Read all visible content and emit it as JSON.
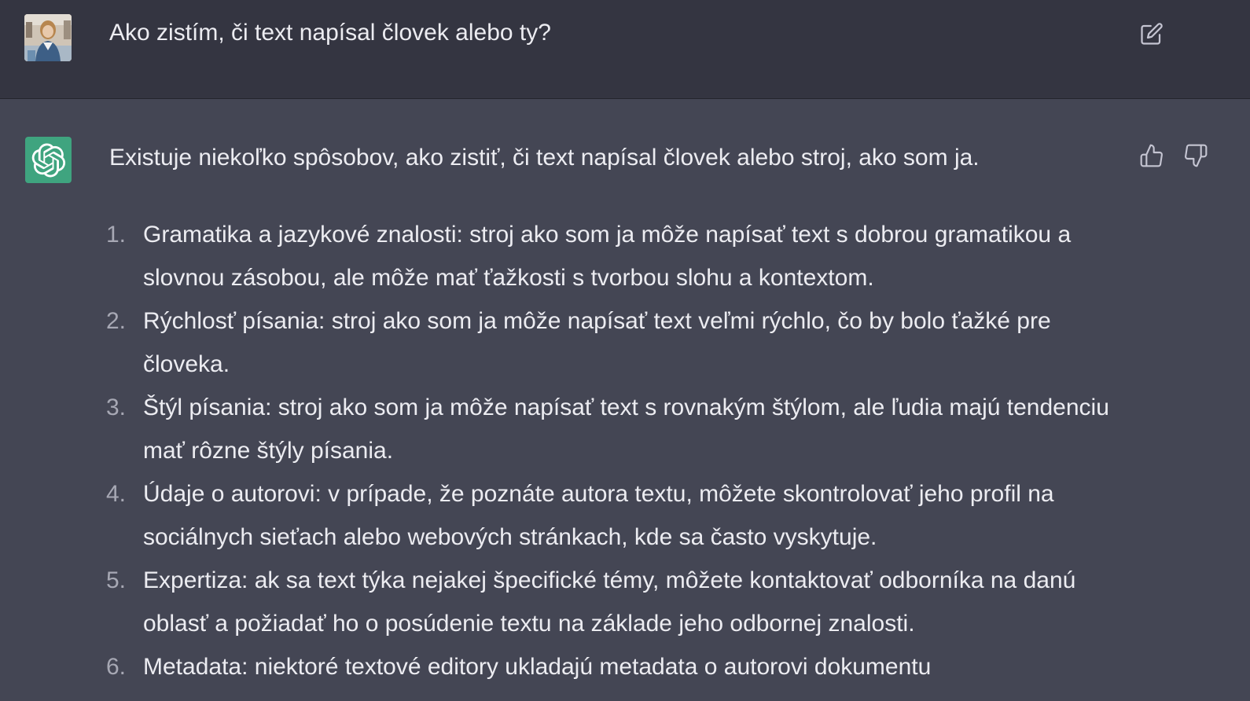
{
  "user_message": {
    "text": "Ako zistím, či text napísal človek alebo ty?",
    "avatar_icon": "user-photo-avatar",
    "edit_icon": "edit-pencil-icon"
  },
  "assistant_message": {
    "avatar_icon": "openai-logo-icon",
    "intro": "Existuje niekoľko spôsobov, ako zistiť, či text napísal človek alebo stroj, ako som ja.",
    "items": [
      {
        "number": "1.",
        "text": "Gramatika a jazykové znalosti: stroj ako som ja môže napísať text s dobrou gramatikou a slovnou zásobou, ale môže mať ťažkosti s tvorbou slohu a kontextom."
      },
      {
        "number": "2.",
        "text": "Rýchlosť písania: stroj ako som ja môže napísať text veľmi rýchlo, čo by bolo ťažké pre človeka."
      },
      {
        "number": "3.",
        "text": "Štýl písania: stroj ako som ja môže napísať text s rovnakým štýlom, ale ľudia majú tendenciu mať rôzne štýly písania."
      },
      {
        "number": "4.",
        "text": "Údaje o autorovi: v prípade, že poznáte autora textu, môžete skontrolovať jeho profil na sociálnych sieťach alebo webových stránkach, kde sa často vyskytuje."
      },
      {
        "number": "5.",
        "text": "Expertiza: ak sa text týka nejakej špecifické témy, môžete kontaktovať odborníka na danú oblasť a požiadať ho o posúdenie textu na základe jeho odbornej znalosti."
      },
      {
        "number": "6.",
        "text": "Metadata: niektoré textové editory ukladajú metadata o autorovi dokumentu"
      }
    ],
    "thumbs_up_icon": "thumbs-up-icon",
    "thumbs_down_icon": "thumbs-down-icon"
  },
  "colors": {
    "user_bg": "#343541",
    "assistant_bg": "#444654",
    "gpt_avatar": "#3fa47f",
    "text": "#ececf1",
    "muted": "#a7a8b4"
  }
}
